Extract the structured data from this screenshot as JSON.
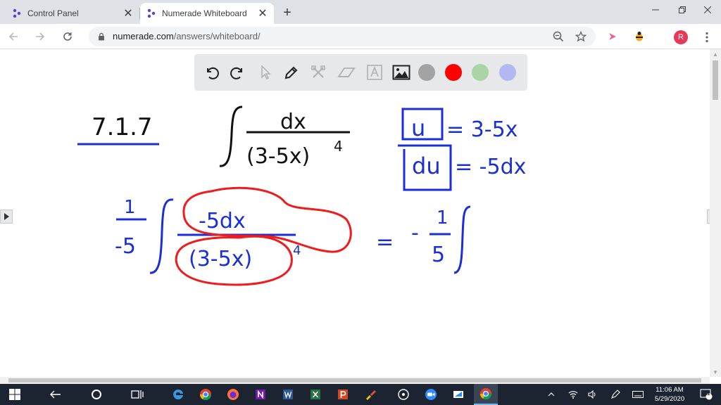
{
  "browser": {
    "tabs": [
      {
        "title": "Control Panel",
        "active": false
      },
      {
        "title": "Numerade Whiteboard",
        "active": true
      }
    ],
    "address": {
      "host": "numerade.com",
      "path": "/answers/whiteboard/"
    },
    "profile_initial": "R"
  },
  "whiteboard": {
    "tools": [
      "undo-icon",
      "redo-icon",
      "pointer-icon",
      "pen-icon",
      "clear-icon",
      "eraser-icon",
      "text-icon",
      "image-icon"
    ],
    "colors": [
      "#a3a3a3",
      "#ff0000",
      "#a8d4a8",
      "#b4b8f0"
    ],
    "ink": {
      "problem_number": "7.1.7",
      "integral_numerator": "dx",
      "integral_denominator": "(3-5x)",
      "exponent": "4",
      "sub_u_var": "u",
      "sub_u_expr": "= 3-5x",
      "sub_du_var": "du",
      "sub_du_expr": "= -5dx",
      "coef_numerator": "1",
      "coef_denominator": "-5",
      "step_numerator": "-5dx",
      "step_denominator": "(3-5x)",
      "step_exponent": "4",
      "result_equals": "=",
      "result_minus": "-",
      "result_numerator": "1",
      "result_denominator": "5"
    }
  },
  "taskbar": {
    "time": "11:06 AM",
    "date": "5/29/2020",
    "notifications": "11"
  }
}
